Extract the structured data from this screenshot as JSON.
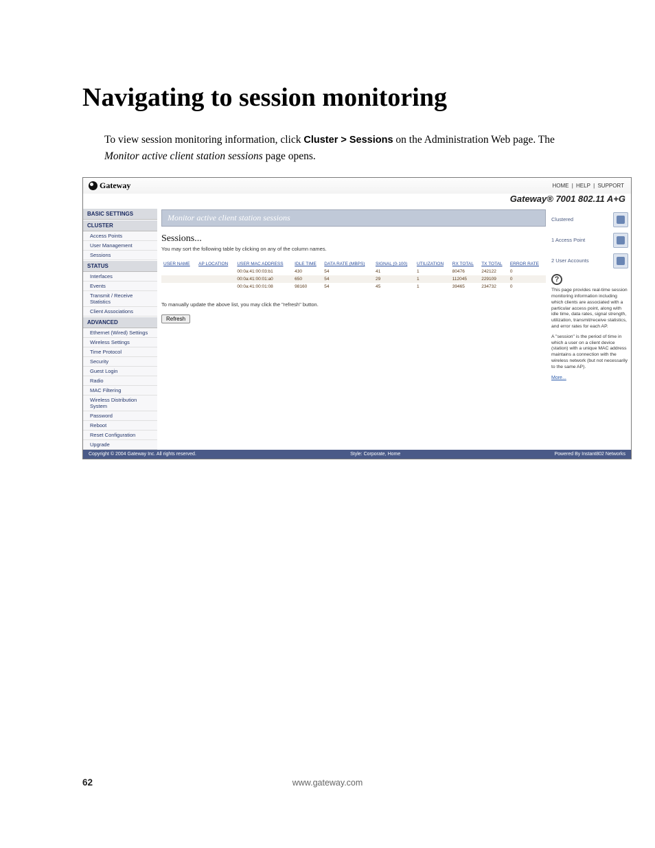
{
  "page_title": "Navigating to session monitoring",
  "intro_pre": "To view session monitoring information, click ",
  "intro_click": "Cluster > Sessions",
  "intro_mid": " on the Administration Web page. The ",
  "intro_italic": "Monitor active client station sessions",
  "intro_post": " page opens.",
  "brand": "Gateway",
  "top_link_1": "Home",
  "top_link_2": "Help",
  "top_link_3": "Support",
  "product_line": "Gateway® 7001 802.11 A+G",
  "nav": {
    "sec_basic": "BASIC SETTINGS",
    "sec_cluster": "CLUSTER",
    "cluster_items": [
      "Access Points",
      "User Management",
      "Sessions"
    ],
    "sec_status": "STATUS",
    "status_items": [
      "Interfaces",
      "Events",
      "Transmit / Receive Statistics",
      "Client Associations"
    ],
    "sec_advanced": "ADVANCED",
    "advanced_items": [
      "Ethernet (Wired) Settings",
      "Wireless Settings",
      "Time Protocol",
      "Security",
      "Guest Login",
      "Radio",
      "MAC Filtering",
      "Wireless Distribution System",
      "Password",
      "Reboot",
      "Reset Configuration",
      "Upgrade"
    ]
  },
  "panel_heading": "Monitor active client station sessions",
  "sessions_label": "Sessions...",
  "sort_hint": "You may sort the following table by clicking on any of the column names.",
  "table_headers": [
    "USER NAME",
    "AP LOCATION",
    "USER MAC ADDRESS",
    "IDLE TIME",
    "DATA RATE (MBPS)",
    "SIGNAL (0-100)",
    "UTILIZATION",
    "RX TOTAL",
    "TX TOTAL",
    "ERROR RATE"
  ],
  "table_rows": [
    [
      "",
      "",
      "00:0a:41:00:03:b1",
      "430",
      "54",
      "41",
      "1",
      "80476",
      "242122",
      "0"
    ],
    [
      "",
      "",
      "00:0a:41:00:01:a0",
      "650",
      "54",
      "29",
      "1",
      "112045",
      "229109",
      "0"
    ],
    [
      "",
      "",
      "00:0a:41:00:01:08",
      "98160",
      "54",
      "45",
      "1",
      "39465",
      "234732",
      "0"
    ]
  ],
  "refresh_hint": "To manually update the above list, you may click the \"refresh\" button.",
  "refresh_label": "Refresh",
  "stats": [
    {
      "label": "Clustered"
    },
    {
      "label": "1 Access Point"
    },
    {
      "label": "2 User Accounts"
    }
  ],
  "help_intro": "This page provides real-time session monitoring information including which clients are associated with a particular access point, along with idle time, data rates, signal strength, utilization, transmit/receive statistics, and error rates for each AP.",
  "help_session": "A \"session\" is the period of time in which a user on a client device (station) with a unique MAC address maintains a connection with the wireless network (but not necessarily to the same AP).",
  "more_label": "More...",
  "foot_copy": "Copyright © 2004 Gateway Inc. All rights reserved.",
  "foot_style": "Style: Corporate, Home",
  "foot_powered": "Powered By Instant802 Networks",
  "page_number": "62",
  "page_url": "www.gateway.com"
}
